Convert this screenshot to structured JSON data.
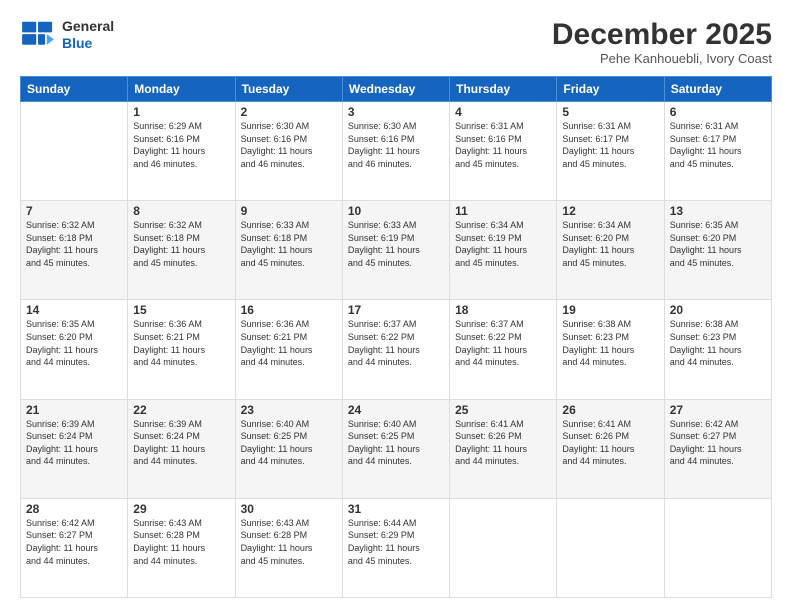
{
  "logo": {
    "line1": "General",
    "line2": "Blue"
  },
  "header": {
    "month": "December 2025",
    "location": "Pehe Kanhouebli, Ivory Coast"
  },
  "days_of_week": [
    "Sunday",
    "Monday",
    "Tuesday",
    "Wednesday",
    "Thursday",
    "Friday",
    "Saturday"
  ],
  "weeks": [
    [
      {
        "day": "",
        "info": ""
      },
      {
        "day": "1",
        "info": "Sunrise: 6:29 AM\nSunset: 6:16 PM\nDaylight: 11 hours\nand 46 minutes."
      },
      {
        "day": "2",
        "info": "Sunrise: 6:30 AM\nSunset: 6:16 PM\nDaylight: 11 hours\nand 46 minutes."
      },
      {
        "day": "3",
        "info": "Sunrise: 6:30 AM\nSunset: 6:16 PM\nDaylight: 11 hours\nand 46 minutes."
      },
      {
        "day": "4",
        "info": "Sunrise: 6:31 AM\nSunset: 6:16 PM\nDaylight: 11 hours\nand 45 minutes."
      },
      {
        "day": "5",
        "info": "Sunrise: 6:31 AM\nSunset: 6:17 PM\nDaylight: 11 hours\nand 45 minutes."
      },
      {
        "day": "6",
        "info": "Sunrise: 6:31 AM\nSunset: 6:17 PM\nDaylight: 11 hours\nand 45 minutes."
      }
    ],
    [
      {
        "day": "7",
        "info": "Sunrise: 6:32 AM\nSunset: 6:18 PM\nDaylight: 11 hours\nand 45 minutes."
      },
      {
        "day": "8",
        "info": "Sunrise: 6:32 AM\nSunset: 6:18 PM\nDaylight: 11 hours\nand 45 minutes."
      },
      {
        "day": "9",
        "info": "Sunrise: 6:33 AM\nSunset: 6:18 PM\nDaylight: 11 hours\nand 45 minutes."
      },
      {
        "day": "10",
        "info": "Sunrise: 6:33 AM\nSunset: 6:19 PM\nDaylight: 11 hours\nand 45 minutes."
      },
      {
        "day": "11",
        "info": "Sunrise: 6:34 AM\nSunset: 6:19 PM\nDaylight: 11 hours\nand 45 minutes."
      },
      {
        "day": "12",
        "info": "Sunrise: 6:34 AM\nSunset: 6:20 PM\nDaylight: 11 hours\nand 45 minutes."
      },
      {
        "day": "13",
        "info": "Sunrise: 6:35 AM\nSunset: 6:20 PM\nDaylight: 11 hours\nand 45 minutes."
      }
    ],
    [
      {
        "day": "14",
        "info": "Sunrise: 6:35 AM\nSunset: 6:20 PM\nDaylight: 11 hours\nand 44 minutes."
      },
      {
        "day": "15",
        "info": "Sunrise: 6:36 AM\nSunset: 6:21 PM\nDaylight: 11 hours\nand 44 minutes."
      },
      {
        "day": "16",
        "info": "Sunrise: 6:36 AM\nSunset: 6:21 PM\nDaylight: 11 hours\nand 44 minutes."
      },
      {
        "day": "17",
        "info": "Sunrise: 6:37 AM\nSunset: 6:22 PM\nDaylight: 11 hours\nand 44 minutes."
      },
      {
        "day": "18",
        "info": "Sunrise: 6:37 AM\nSunset: 6:22 PM\nDaylight: 11 hours\nand 44 minutes."
      },
      {
        "day": "19",
        "info": "Sunrise: 6:38 AM\nSunset: 6:23 PM\nDaylight: 11 hours\nand 44 minutes."
      },
      {
        "day": "20",
        "info": "Sunrise: 6:38 AM\nSunset: 6:23 PM\nDaylight: 11 hours\nand 44 minutes."
      }
    ],
    [
      {
        "day": "21",
        "info": "Sunrise: 6:39 AM\nSunset: 6:24 PM\nDaylight: 11 hours\nand 44 minutes."
      },
      {
        "day": "22",
        "info": "Sunrise: 6:39 AM\nSunset: 6:24 PM\nDaylight: 11 hours\nand 44 minutes."
      },
      {
        "day": "23",
        "info": "Sunrise: 6:40 AM\nSunset: 6:25 PM\nDaylight: 11 hours\nand 44 minutes."
      },
      {
        "day": "24",
        "info": "Sunrise: 6:40 AM\nSunset: 6:25 PM\nDaylight: 11 hours\nand 44 minutes."
      },
      {
        "day": "25",
        "info": "Sunrise: 6:41 AM\nSunset: 6:26 PM\nDaylight: 11 hours\nand 44 minutes."
      },
      {
        "day": "26",
        "info": "Sunrise: 6:41 AM\nSunset: 6:26 PM\nDaylight: 11 hours\nand 44 minutes."
      },
      {
        "day": "27",
        "info": "Sunrise: 6:42 AM\nSunset: 6:27 PM\nDaylight: 11 hours\nand 44 minutes."
      }
    ],
    [
      {
        "day": "28",
        "info": "Sunrise: 6:42 AM\nSunset: 6:27 PM\nDaylight: 11 hours\nand 44 minutes."
      },
      {
        "day": "29",
        "info": "Sunrise: 6:43 AM\nSunset: 6:28 PM\nDaylight: 11 hours\nand 44 minutes."
      },
      {
        "day": "30",
        "info": "Sunrise: 6:43 AM\nSunset: 6:28 PM\nDaylight: 11 hours\nand 45 minutes."
      },
      {
        "day": "31",
        "info": "Sunrise: 6:44 AM\nSunset: 6:29 PM\nDaylight: 11 hours\nand 45 minutes."
      },
      {
        "day": "",
        "info": ""
      },
      {
        "day": "",
        "info": ""
      },
      {
        "day": "",
        "info": ""
      }
    ]
  ]
}
